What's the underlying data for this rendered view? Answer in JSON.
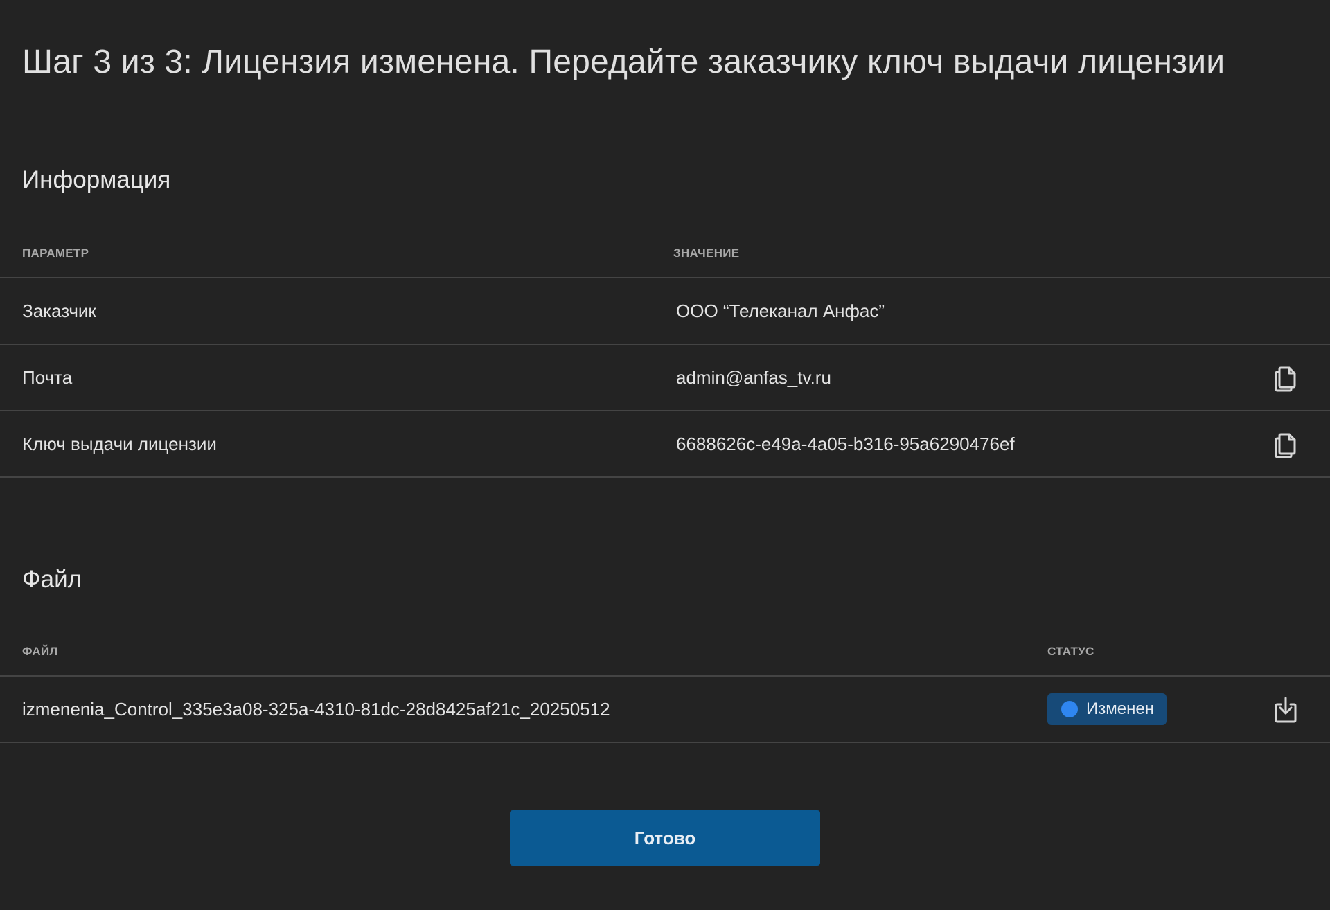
{
  "header": {
    "title": "Шаг 3 из 3: Лицензия изменена. Передайте заказчику ключ выдачи лицензии"
  },
  "info": {
    "title": "Информация",
    "columns": [
      "ПАРАМЕТР",
      "ЗНАЧЕНИЕ"
    ],
    "rows": [
      {
        "param": "Заказчик",
        "value": "ООО “Телеканал Анфас”",
        "action_icon": ""
      },
      {
        "param": "Почта",
        "value": "admin@anfas_tv.ru",
        "action_icon": "copy-icon"
      },
      {
        "param": "Ключ выдачи лицензии",
        "value": "6688626c-e49a-4a05-b316-95a6290476ef",
        "action_icon": "copy-icon"
      }
    ]
  },
  "files": {
    "title": "Файл",
    "columns": [
      "ФАЙЛ",
      "СТАТУС"
    ],
    "rows": [
      {
        "name": "izmenenia_Control_335e3a08-325a-4310-81dc-28d8425af21c_20250512",
        "status": "Изменен",
        "action_icon": "download-icon"
      }
    ]
  },
  "actions": {
    "done_label": "Готово"
  },
  "colors": {
    "background": "#232323",
    "text": "#e3e3e3",
    "muted": "#a8a8a8",
    "divider": "#444444",
    "badge_bg": "#174a78",
    "badge_dot": "#2f86f0",
    "primary_button": "#0b5a93"
  }
}
